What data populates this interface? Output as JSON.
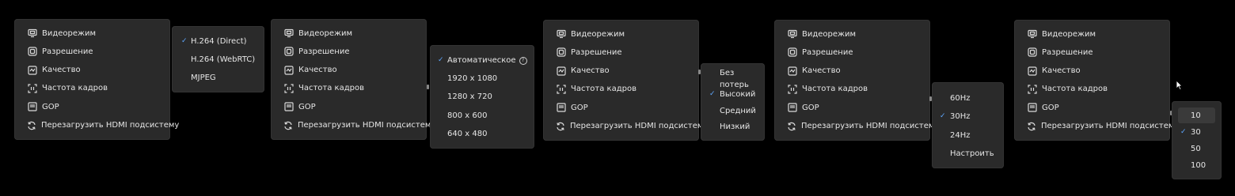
{
  "menu": {
    "items": [
      {
        "label": "Видеорежим",
        "icon": "monitor-icon"
      },
      {
        "label": "Разрешение",
        "icon": "resolution-icon"
      },
      {
        "label": "Качество",
        "icon": "quality-icon"
      },
      {
        "label": "Частота кадров",
        "icon": "framerate-icon"
      },
      {
        "label": "GOP",
        "icon": "gop-icon"
      },
      {
        "label": "Перезагрузить HDMI подсистему",
        "icon": "refresh-icon"
      }
    ]
  },
  "video_mode_submenu": {
    "options": [
      {
        "label": "H.264 (Direct)",
        "checked": true
      },
      {
        "label": "H.264 (WebRTC)",
        "checked": false
      },
      {
        "label": "MJPEG",
        "checked": false
      }
    ]
  },
  "resolution_submenu": {
    "options": [
      {
        "label": "Автоматическое",
        "checked": true,
        "help": "?"
      },
      {
        "label": "1920 x 1080",
        "checked": false
      },
      {
        "label": "1280 x 720",
        "checked": false
      },
      {
        "label": "800 x 600",
        "checked": false
      },
      {
        "label": "640 x 480",
        "checked": false
      }
    ]
  },
  "quality_submenu": {
    "options": [
      {
        "label": "Без потерь",
        "checked": false
      },
      {
        "label": "Высокий",
        "checked": true
      },
      {
        "label": "Средний",
        "checked": false
      },
      {
        "label": "Низкий",
        "checked": false
      }
    ]
  },
  "framerate_submenu": {
    "options": [
      {
        "label": "60Hz",
        "checked": false
      },
      {
        "label": "30Hz",
        "checked": true
      },
      {
        "label": "24Hz",
        "checked": false
      },
      {
        "label": "Настроить",
        "checked": false
      }
    ]
  },
  "gop_submenu": {
    "options": [
      {
        "label": "10",
        "checked": false,
        "highlighted": true
      },
      {
        "label": "30",
        "checked": true
      },
      {
        "label": "50",
        "checked": false
      },
      {
        "label": "100",
        "checked": false
      }
    ]
  },
  "colors": {
    "background": "#000000",
    "menu_bg": "#2a2a2a",
    "check": "#5fa8ff"
  }
}
